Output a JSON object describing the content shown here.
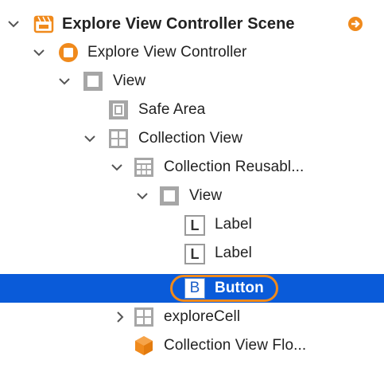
{
  "outline": {
    "scene_title": "Explore View Controller Scene",
    "items": [
      {
        "label": "Explore View Controller",
        "icon": "view-controller-icon"
      },
      {
        "label": "View",
        "icon": "view-icon"
      },
      {
        "label": "Safe Area",
        "icon": "safe-area-icon"
      },
      {
        "label": "Collection View",
        "icon": "collection-view-icon"
      },
      {
        "label": "Collection Reusabl...",
        "icon": "collection-reusable-view-icon"
      },
      {
        "label": "View",
        "icon": "view-icon"
      },
      {
        "label": "Label",
        "icon": "label-icon",
        "glyph": "L"
      },
      {
        "label": "Label",
        "icon": "label-icon",
        "glyph": "L"
      },
      {
        "label": "Button",
        "icon": "button-icon",
        "glyph": "B",
        "selected": true
      },
      {
        "label": "exploreCell",
        "icon": "collection-view-cell-icon"
      },
      {
        "label": "Collection View Flo...",
        "icon": "flow-layout-icon"
      }
    ]
  },
  "colors": {
    "selection": "#0a5bd9",
    "accent_orange": "#f08a1c",
    "icon_gray": "#9a9a9a"
  }
}
